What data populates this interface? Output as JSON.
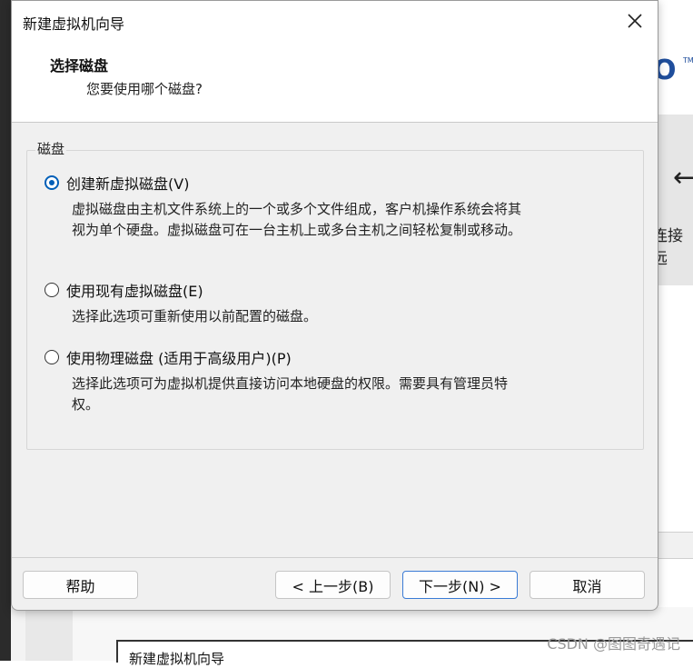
{
  "dialog": {
    "title": "新建虚拟机向导",
    "header_title": "选择磁盘",
    "header_subtitle": "您要使用哪个磁盘?",
    "group_label": "磁盘",
    "options": [
      {
        "label": "创建新虚拟磁盘(V)",
        "selected": true,
        "desc_line1": "虚拟磁盘由主机文件系统上的一个或多个文件组成，客户机操作系统会将其",
        "desc_line2": "视为单个硬盘。虚拟磁盘可在一台主机上或多台主机之间轻松复制或移动。"
      },
      {
        "label": "使用现有虚拟磁盘(E)",
        "selected": false,
        "desc_line1": "选择此选项可重新使用以前配置的磁盘。"
      },
      {
        "label": "使用物理磁盘 (适用于高级用户)(P)",
        "selected": false,
        "desc_line1": "选择此选项可为虚拟机提供直接访问本地硬盘的权限。需要具有管理员特",
        "desc_line2": "权。"
      }
    ],
    "buttons": {
      "help": "帮助",
      "back": "< 上一步(B)",
      "next": "下一步(N) >",
      "cancel": "取消"
    },
    "icons": {
      "close": "close-icon"
    }
  },
  "background": {
    "right_logo": "O",
    "right_tm": "TM",
    "right_label": "连接远",
    "right_arrow_icon": "arrow-left-icon",
    "bottom_window_title": "新建虚拟机向导"
  },
  "watermark": "CSDN @图图奇遇记",
  "colors": {
    "accent": "#005fb8",
    "dialog_bg": "#f0f0f0"
  }
}
